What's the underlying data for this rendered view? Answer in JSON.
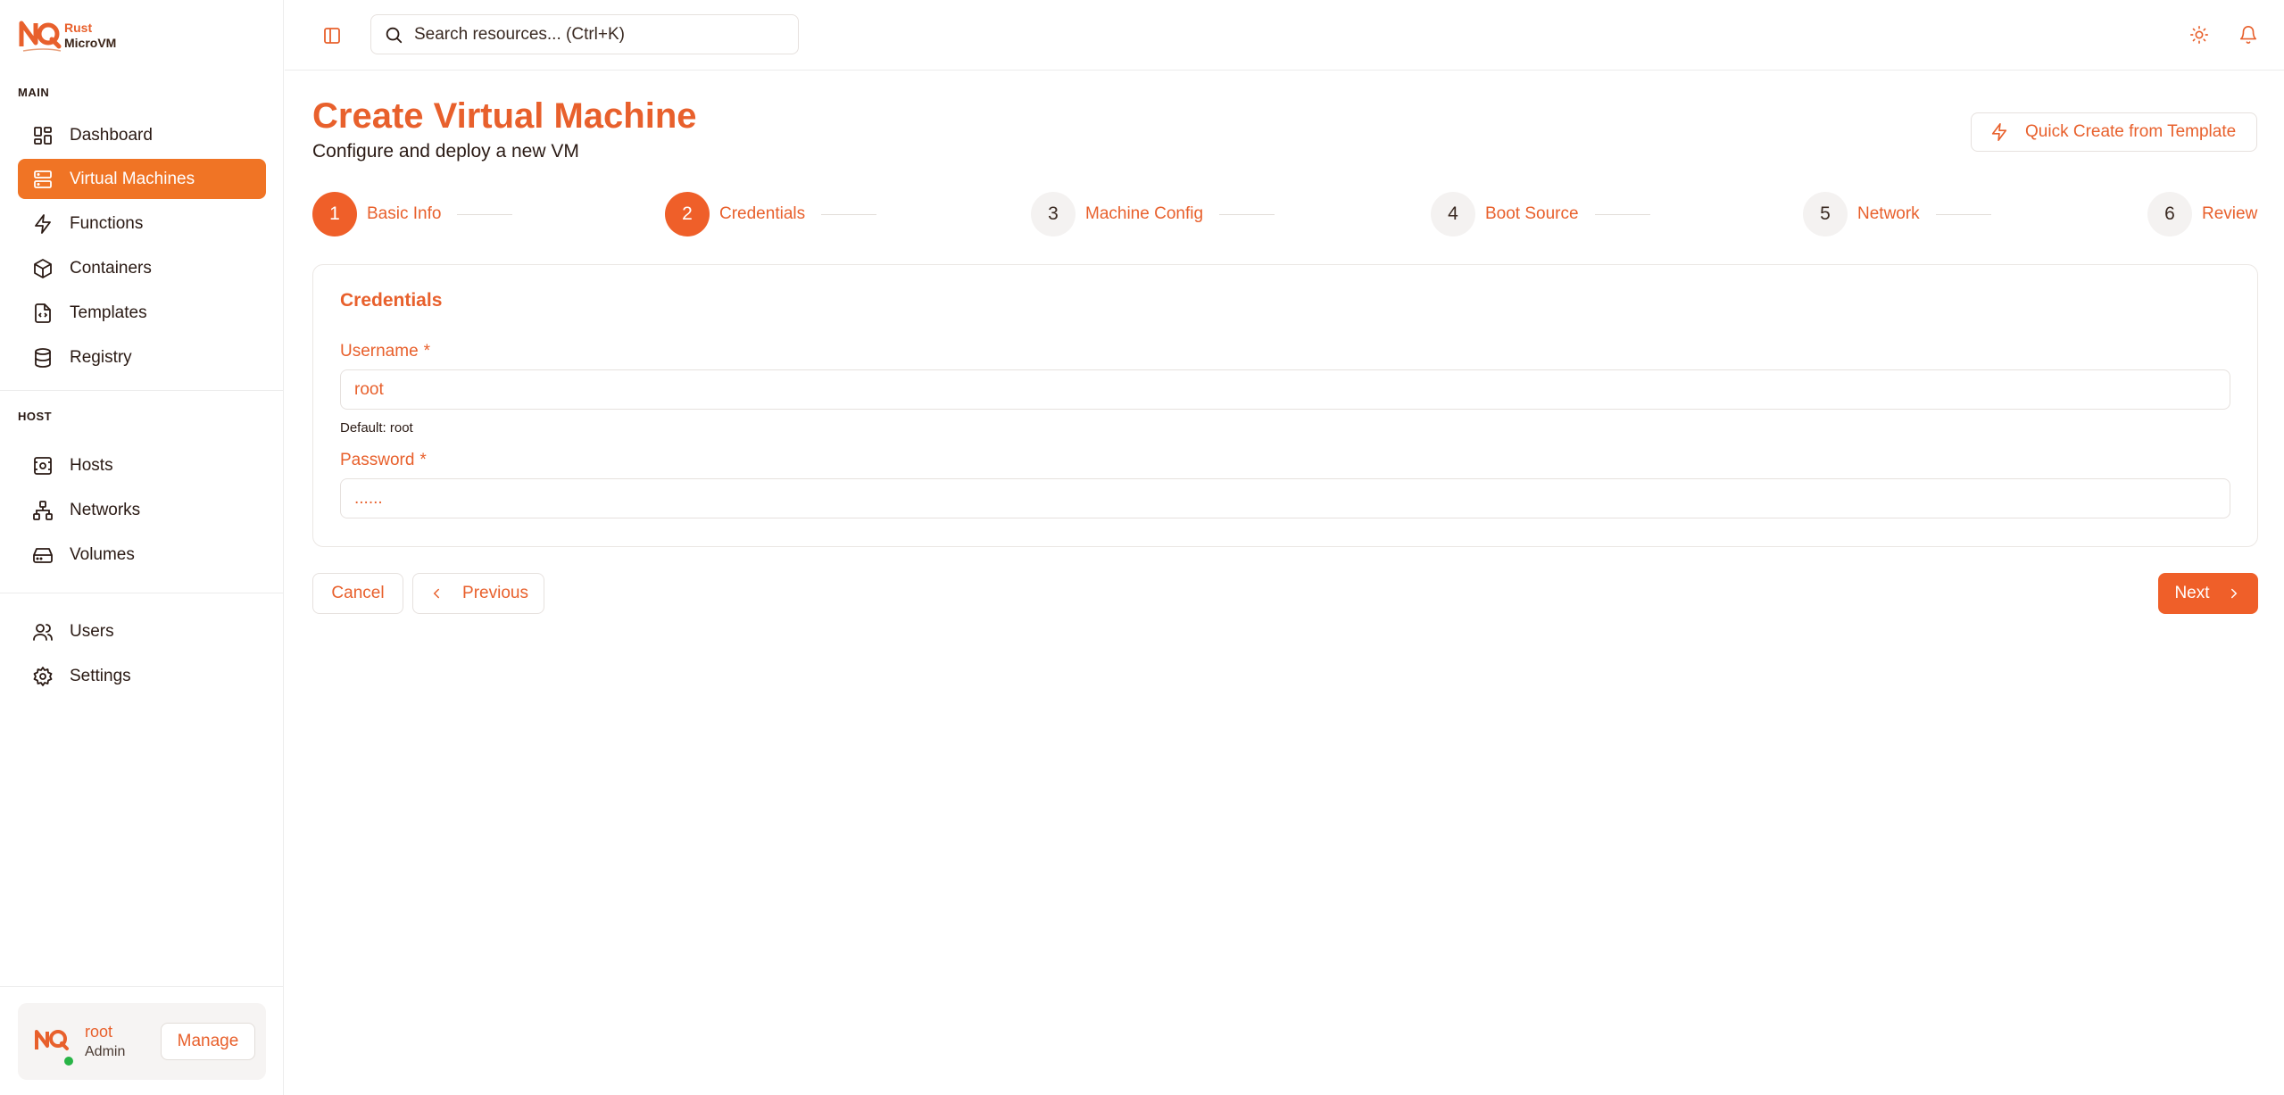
{
  "brand": {
    "line1": "Rust",
    "line2": "MicroVM",
    "accent": "#e8602c"
  },
  "sidebar": {
    "main_label": "MAIN",
    "host_label": "HOST",
    "main_items": [
      {
        "label": "Dashboard",
        "icon": "dashboard-icon"
      },
      {
        "label": "Virtual Machines",
        "icon": "server-icon",
        "active": true
      },
      {
        "label": "Functions",
        "icon": "lightning-icon"
      },
      {
        "label": "Containers",
        "icon": "box-icon"
      },
      {
        "label": "Templates",
        "icon": "file-code-icon"
      },
      {
        "label": "Registry",
        "icon": "database-icon"
      }
    ],
    "host_items": [
      {
        "label": "Hosts",
        "icon": "host-icon"
      },
      {
        "label": "Networks",
        "icon": "network-icon"
      },
      {
        "label": "Volumes",
        "icon": "hard-drive-icon"
      }
    ],
    "admin_items": [
      {
        "label": "Users",
        "icon": "users-icon"
      },
      {
        "label": "Settings",
        "icon": "gear-icon"
      }
    ],
    "user": {
      "name": "root",
      "role": "Admin",
      "manage_label": "Manage"
    }
  },
  "topbar": {
    "search_placeholder": "Search resources... (Ctrl+K)"
  },
  "page": {
    "title": "Create Virtual Machine",
    "subtitle": "Configure and deploy a new VM",
    "quick_create_label": "Quick Create from Template"
  },
  "steps": [
    {
      "num": "1",
      "label": "Basic Info"
    },
    {
      "num": "2",
      "label": "Credentials"
    },
    {
      "num": "3",
      "label": "Machine Config"
    },
    {
      "num": "4",
      "label": "Boot Source"
    },
    {
      "num": "5",
      "label": "Network"
    },
    {
      "num": "6",
      "label": "Review"
    }
  ],
  "form": {
    "section_title": "Credentials",
    "username_label": "Username",
    "username_value": "root",
    "username_hint": "Default: root",
    "password_label": "Password",
    "password_value": "......",
    "required_mark": "*"
  },
  "actions": {
    "cancel": "Cancel",
    "previous": "Previous",
    "next": "Next"
  }
}
